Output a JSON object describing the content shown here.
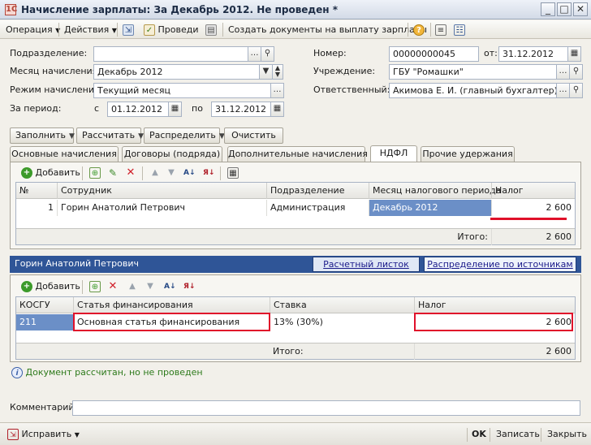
{
  "window": {
    "title": "Начисление зарплаты: За Декабрь 2012. Не проведен *",
    "app_icon": "1С",
    "minimize": "_",
    "maximize": "□",
    "close": "✕"
  },
  "toolbar": {
    "operation": "Операция",
    "actions": "Действия",
    "post": "Проведи",
    "create_docs": "Создать документы на выплату зарплаты"
  },
  "form": {
    "department_label": "Подразделение:",
    "department_value": "",
    "month_label": "Месяц начисления:",
    "month_value": "Декабрь 2012",
    "mode_label": "Режим начисления:",
    "mode_value": "Текущий месяц",
    "period_label": "За период:",
    "period_from_label": "с",
    "period_from": "01.12.2012",
    "period_to_label": "по",
    "period_to": "31.12.2012",
    "number_label": "Номер:",
    "number_value": "00000000045",
    "date_label": "от:",
    "date_value": "31.12.2012",
    "institution_label": "Учреждение:",
    "institution_value": "ГБУ \"Ромашки\"",
    "responsible_label": "Ответственный:",
    "responsible_value": "Акимова Е. И. (главный бухгалтер)"
  },
  "actions": {
    "fill": "Заполнить",
    "calculate": "Рассчитать",
    "distribute": "Распределить",
    "clear": "Очистить"
  },
  "tabs": [
    {
      "label": "Основные начисления"
    },
    {
      "label": "Договоры (подряда)"
    },
    {
      "label": "Дополнительные начисления"
    },
    {
      "label": "НДФЛ"
    },
    {
      "label": "Прочие удержания"
    }
  ],
  "upper_grid": {
    "add_label": "Добавить",
    "columns": [
      "№",
      "Сотрудник",
      "Подразделение",
      "Месяц налогового периода",
      "Налог"
    ],
    "rows": [
      {
        "num": "1",
        "employee": "Горин Анатолий Петрович",
        "department": "Администрация",
        "month": "Декабрь 2012",
        "tax": "2 600"
      }
    ],
    "total_label": "Итого:",
    "total_value": "2 600"
  },
  "employee_bar": {
    "name": "Горин Анатолий Петрович",
    "pay_slip": "Расчетный листок",
    "distribution": "Распределение по источникам"
  },
  "lower_grid": {
    "add_label": "Добавить",
    "columns": [
      "КОСГУ",
      "Статья финансирования",
      "Ставка",
      "Налог"
    ],
    "rows": [
      {
        "kosgu": "211",
        "article": "Основная статья финансирования",
        "rate": "13% (30%)",
        "tax": "2 600"
      }
    ],
    "total_label": "Итого:",
    "total_value": "2 600"
  },
  "status": {
    "text": "Документ рассчитан, но не проведен"
  },
  "comment": {
    "label": "Комментарий:",
    "value": ""
  },
  "bottom": {
    "fix": "Исправить",
    "ok": "OK",
    "save": "Записать",
    "close": "Закрыть"
  },
  "colors": {
    "highlight": "#e0102a",
    "selection": "#6b8fc7",
    "bar": "#2f5597"
  }
}
